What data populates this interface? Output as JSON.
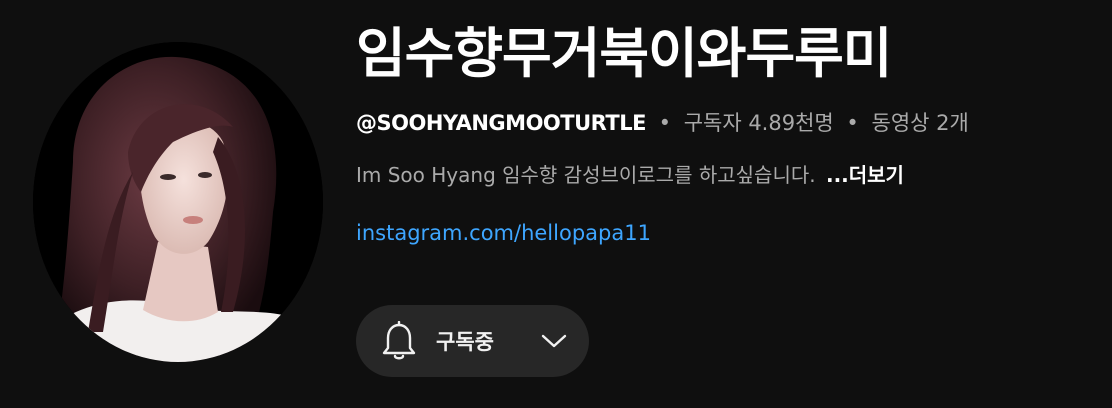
{
  "channel": {
    "title": "임수향무거북이와두루미",
    "handle": "@SOOHYANGMOOTURTLE",
    "separator": "•",
    "subscribers": "구독자 4.89천명",
    "videos": "동영상 2개",
    "description": "Im Soo Hyang 임수향 감성브이로그를 하고싶습니다.",
    "more_label": "...더보기",
    "link_text": "instagram.com/hellopapa11"
  },
  "subscribe_button": {
    "label": "구독중",
    "icon": "bell-icon",
    "dropdown_icon": "chevron-down-icon"
  },
  "colors": {
    "background": "#0f0f0f",
    "title": "#ffffff",
    "secondary_text": "#aaaaaa",
    "link": "#3ea6ff",
    "button_bg": "#272727"
  }
}
